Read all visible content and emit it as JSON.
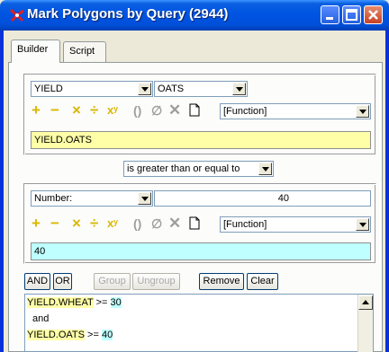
{
  "window": {
    "title": "Mark Polygons by Query (2944)"
  },
  "tabs": [
    {
      "label": "Builder"
    },
    {
      "label": "Script"
    }
  ],
  "left_operand": {
    "field": "YIELD",
    "value": "OATS",
    "function": "[Function]",
    "expression": "YIELD.OATS"
  },
  "operator": "is greater than or equal to",
  "right_operand": {
    "type": "Number:",
    "number": "40",
    "function": "[Function]",
    "expression": "40"
  },
  "buttons": {
    "and": "AND",
    "or": "OR",
    "group": "Group",
    "ungroup": "Ungroup",
    "remove": "Remove",
    "clear": "Clear"
  },
  "query_lines": {
    "line1_field": "YIELD.WHEAT",
    "line1_op": ">=",
    "line1_value": "30",
    "line2": "and",
    "line3_field": "YIELD.OATS",
    "line3_op": ">=",
    "line3_value": "40"
  },
  "colors": {
    "title_bar": "#0054E3",
    "left_expr_bg": "#FFFFA8",
    "right_expr_bg": "#BFFFFF"
  }
}
